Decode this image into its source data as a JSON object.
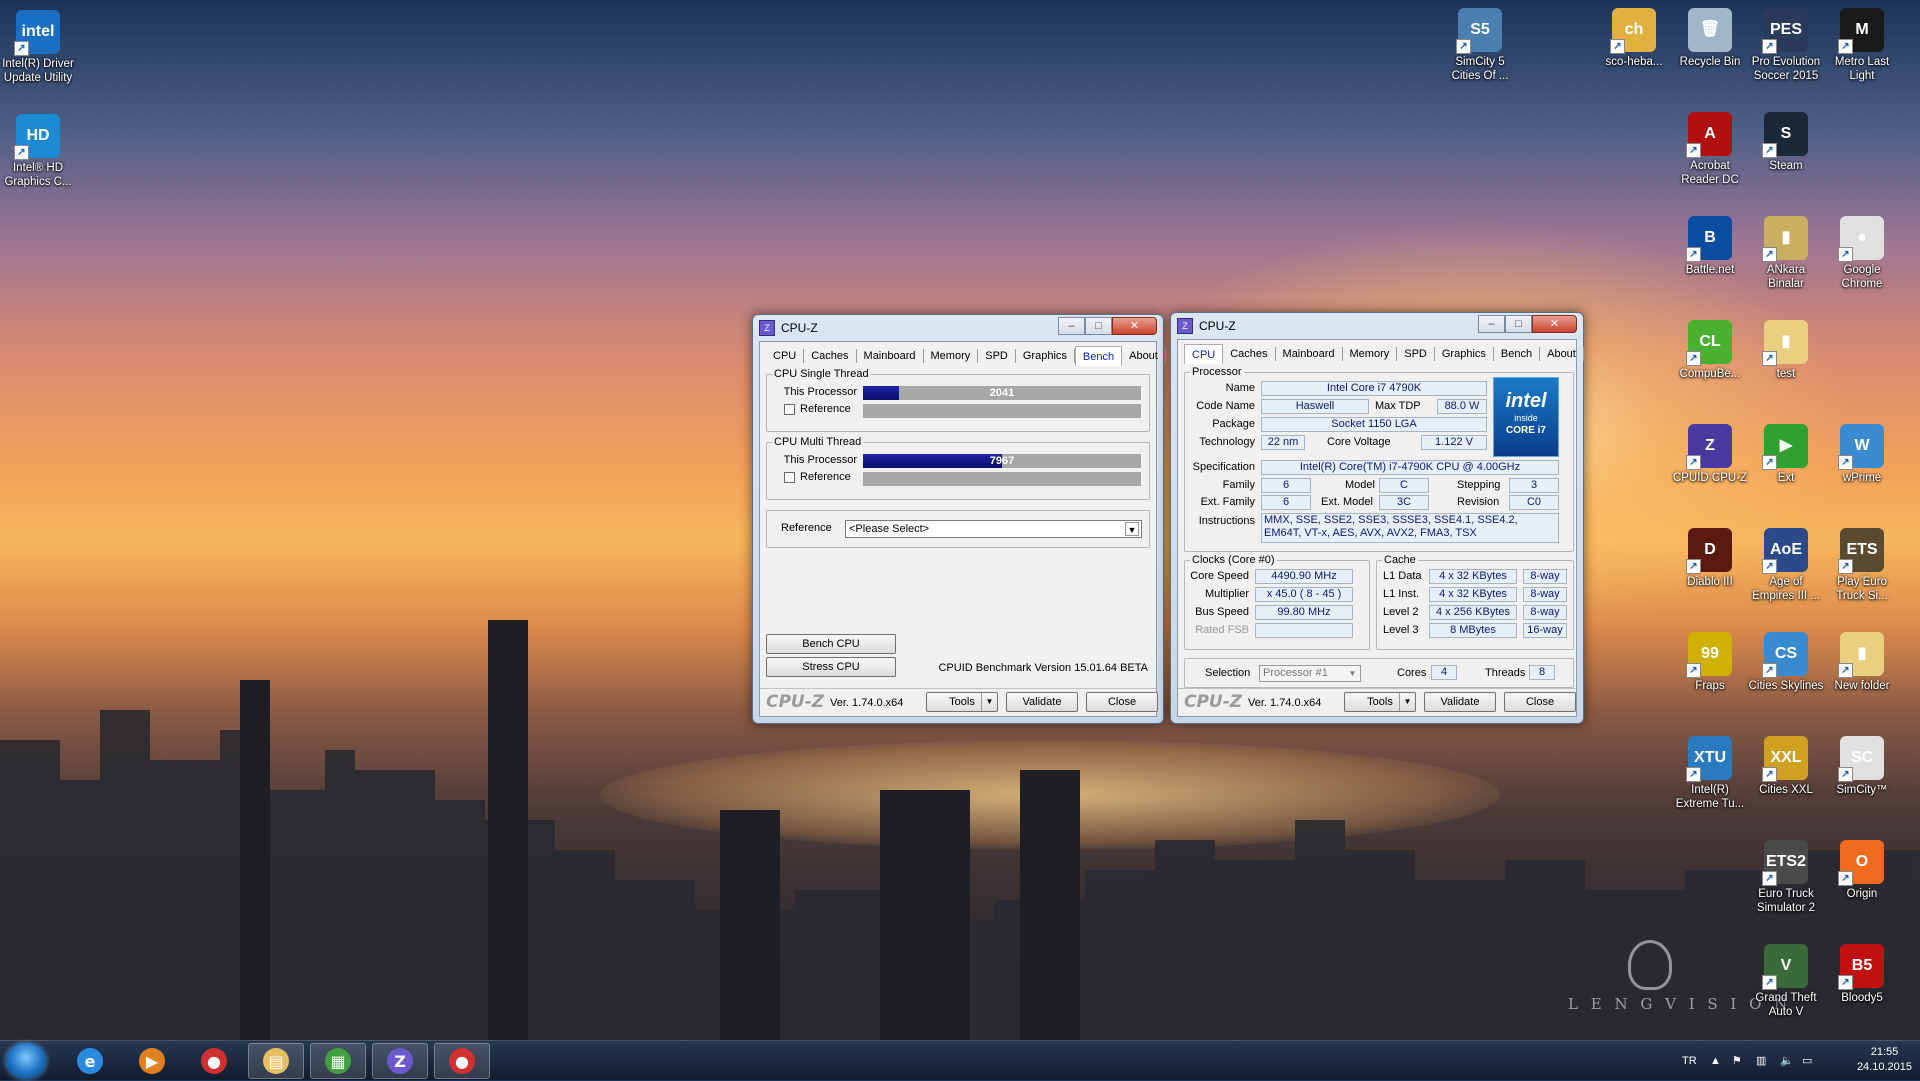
{
  "desktop": {
    "left_icons": [
      {
        "label": "Intel(R) Driver Update Utility",
        "color": "#1a6fc4",
        "glyph": "intel"
      },
      {
        "label": "Intel® HD Graphics C...",
        "color": "#1c8ad4",
        "glyph": "HD"
      }
    ],
    "right_icons": [
      {
        "label": "SimCity 5 Cities Of ...",
        "color": "#4a7fb0",
        "glyph": "S5"
      },
      {
        "label": "sco-heba...",
        "color": "#e0b040",
        "glyph": "ch"
      },
      {
        "label": "Recycle Bin",
        "color": "#9fb7c8",
        "glyph": "🗑"
      },
      {
        "label": "Pro Evolution Soccer 2015",
        "color": "#2a3a5a",
        "glyph": "PES"
      },
      {
        "label": "Metro Last Light",
        "color": "#1a1a1a",
        "glyph": "M"
      },
      {
        "label": "Acrobat Reader DC",
        "color": "#b01010",
        "glyph": "A"
      },
      {
        "label": "Steam",
        "color": "#1b2838",
        "glyph": "S"
      },
      {
        "label": "Battle.net",
        "color": "#0a4ca0",
        "glyph": "B"
      },
      {
        "label": "ANkara Binalar",
        "color": "#c8b060",
        "glyph": "▮"
      },
      {
        "label": "Google Chrome",
        "color": "#e0e0e0",
        "glyph": "●"
      },
      {
        "label": "CompuBe...",
        "color": "#4ab030",
        "glyph": "CL"
      },
      {
        "label": "test",
        "color": "#e8d080",
        "glyph": "▮"
      },
      {
        "label": "CPUID CPU-Z",
        "color": "#4a3aa0",
        "glyph": "Z"
      },
      {
        "label": "Ext",
        "color": "#30a030",
        "glyph": "▶"
      },
      {
        "label": "wPrime",
        "color": "#3a8ad0",
        "glyph": "W"
      },
      {
        "label": "Diablo III",
        "color": "#5a1a10",
        "glyph": "D"
      },
      {
        "label": "Age of Empires III ...",
        "color": "#2a4a8a",
        "glyph": "AoE"
      },
      {
        "label": "Play Euro Truck Si...",
        "color": "#5a4a30",
        "glyph": "ETS"
      },
      {
        "label": "Fraps",
        "color": "#d0b000",
        "glyph": "99"
      },
      {
        "label": "Cities Skylines",
        "color": "#3a8ad0",
        "glyph": "CS"
      },
      {
        "label": "New folder",
        "color": "#e8d080",
        "glyph": "▮"
      },
      {
        "label": "Intel(R) Extreme Tu...",
        "color": "#2a7ac0",
        "glyph": "XTU"
      },
      {
        "label": "Cities XXL",
        "color": "#d0a020",
        "glyph": "XXL"
      },
      {
        "label": "SimCity™",
        "color": "#e0e0e0",
        "glyph": "SC"
      },
      {
        "label": "Euro Truck Simulator 2",
        "color": "#4a4a4a",
        "glyph": "ETS2"
      },
      {
        "label": "Origin",
        "color": "#f06a20",
        "glyph": "O"
      },
      {
        "label": "Grand Theft Auto V",
        "color": "#3a6a3a",
        "glyph": "V"
      },
      {
        "label": "Bloody5",
        "color": "#c01010",
        "glyph": "B5"
      }
    ],
    "watermark": "L E N G  V I S I O N"
  },
  "bench_window": {
    "title": "CPU-Z",
    "tabs": [
      "CPU",
      "Caches",
      "Mainboard",
      "Memory",
      "SPD",
      "Graphics",
      "Bench",
      "About"
    ],
    "active_tab": "Bench",
    "single_thread": {
      "group_label": "CPU Single Thread",
      "this_processor_label": "This Processor",
      "this_processor_score": "2041",
      "this_processor_fill": 0.13,
      "reference_label": "Reference"
    },
    "multi_thread": {
      "group_label": "CPU Multi Thread",
      "this_processor_label": "This Processor",
      "this_processor_score": "7967",
      "this_processor_fill": 0.5,
      "reference_label": "Reference"
    },
    "reference_select_label": "Reference",
    "reference_select_value": "<Please Select>",
    "bench_cpu_button": "Bench CPU",
    "stress_cpu_button": "Stress CPU",
    "benchmark_version": "CPUID Benchmark Version 15.01.64 BETA",
    "footer": {
      "logo": "CPU-Z",
      "version": "Ver. 1.74.0.x64",
      "tools": "Tools",
      "validate": "Validate",
      "close": "Close"
    }
  },
  "cpu_window": {
    "title": "CPU-Z",
    "tabs": [
      "CPU",
      "Caches",
      "Mainboard",
      "Memory",
      "SPD",
      "Graphics",
      "Bench",
      "About"
    ],
    "active_tab": "CPU",
    "processor": {
      "group_label": "Processor",
      "name_label": "Name",
      "name": "Intel Core i7 4790K",
      "code_name_label": "Code Name",
      "code_name": "Haswell",
      "max_tdp_label": "Max TDP",
      "max_tdp": "88.0 W",
      "package_label": "Package",
      "package": "Socket 1150 LGA",
      "technology_label": "Technology",
      "technology": "22 nm",
      "core_voltage_label": "Core Voltage",
      "core_voltage": "1.122 V",
      "specification_label": "Specification",
      "specification": "Intel(R) Core(TM) i7-4790K CPU @ 4.00GHz",
      "family_label": "Family",
      "family": "6",
      "model_label": "Model",
      "model": "C",
      "stepping_label": "Stepping",
      "stepping": "3",
      "ext_family_label": "Ext. Family",
      "ext_family": "6",
      "ext_model_label": "Ext. Model",
      "ext_model": "3C",
      "revision_label": "Revision",
      "revision": "C0",
      "instructions_label": "Instructions",
      "instructions": "MMX, SSE, SSE2, SSE3, SSSE3, SSE4.1, SSE4.2, EM64T, VT-x, AES, AVX, AVX2, FMA3, TSX",
      "logo_text": "intel",
      "logo_sub1": "inside",
      "logo_sub2": "CORE i7"
    },
    "clocks": {
      "group_label": "Clocks (Core #0)",
      "core_speed_label": "Core Speed",
      "core_speed": "4490.90 MHz",
      "multiplier_label": "Multiplier",
      "multiplier": "x 45.0 ( 8 - 45 )",
      "bus_speed_label": "Bus Speed",
      "bus_speed": "99.80 MHz",
      "rated_fsb_label": "Rated FSB",
      "rated_fsb": ""
    },
    "cache": {
      "group_label": "Cache",
      "rows": [
        {
          "label": "L1 Data",
          "size": "4 x 32 KBytes",
          "assoc": "8-way"
        },
        {
          "label": "L1 Inst.",
          "size": "4 x 32 KBytes",
          "assoc": "8-way"
        },
        {
          "label": "Level 2",
          "size": "4 x 256 KBytes",
          "assoc": "8-way"
        },
        {
          "label": "Level 3",
          "size": "8 MBytes",
          "assoc": "16-way"
        }
      ]
    },
    "selection_label": "Selection",
    "selection_value": "Processor #1",
    "cores_label": "Cores",
    "cores": "4",
    "threads_label": "Threads",
    "threads": "8",
    "footer": {
      "logo": "CPU-Z",
      "version": "Ver. 1.74.0.x64",
      "tools": "Tools",
      "validate": "Validate",
      "close": "Close"
    }
  },
  "taskbar": {
    "language": "TR",
    "time": "21:55",
    "date": "24.10.2015",
    "items": [
      {
        "name": "ie",
        "glyph": "e",
        "color": "#2a8ae0",
        "open": false
      },
      {
        "name": "media-player",
        "glyph": "▶",
        "color": "#e08020",
        "open": false
      },
      {
        "name": "chrome",
        "glyph": "●",
        "color": "#d03030",
        "open": false
      },
      {
        "name": "file-explorer",
        "glyph": "▤",
        "color": "#e8c060",
        "open": true
      },
      {
        "name": "task-manager",
        "glyph": "▦",
        "color": "#40a040",
        "open": true
      },
      {
        "name": "cpu-z",
        "glyph": "Z",
        "color": "#6a5acd",
        "open": true
      },
      {
        "name": "chrome-window",
        "glyph": "●",
        "color": "#d03030",
        "open": true
      }
    ]
  }
}
